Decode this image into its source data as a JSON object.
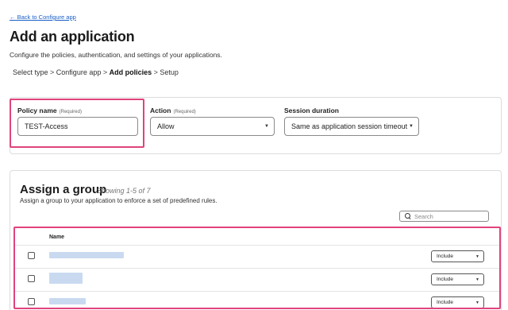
{
  "nav": {
    "back_link": "← Back to Configure app"
  },
  "header": {
    "title": "Add an application",
    "subtitle": "Configure the policies, authentication, and settings of your applications."
  },
  "steps": [
    {
      "label": "Select type",
      "active": false
    },
    {
      "label": "Configure app",
      "active": false
    },
    {
      "label": "Add policies",
      "active": true
    },
    {
      "label": "Setup",
      "active": false
    }
  ],
  "steps_separator": " > ",
  "policy": {
    "name_label": "Policy name",
    "name_required": "(Required)",
    "name_value": "TEST-Access",
    "action_label": "Action",
    "action_required": "(Required)",
    "action_value": "Allow",
    "session_label": "Session duration",
    "session_value": "Same as application session timeout"
  },
  "group": {
    "title": "Assign a group",
    "count": "Showing 1-5 of 7",
    "description": "Assign a group to your application to enforce a set of predefined rules.",
    "search_placeholder": "Search",
    "column_name": "Name",
    "rows": [
      {
        "include": "Include"
      },
      {
        "include": "Include"
      },
      {
        "include": "Include"
      }
    ]
  },
  "colors": {
    "highlight": "#e0447c",
    "link": "#1a5fc6"
  },
  "icons": [
    "search-icon",
    "chevron-down-icon"
  ]
}
